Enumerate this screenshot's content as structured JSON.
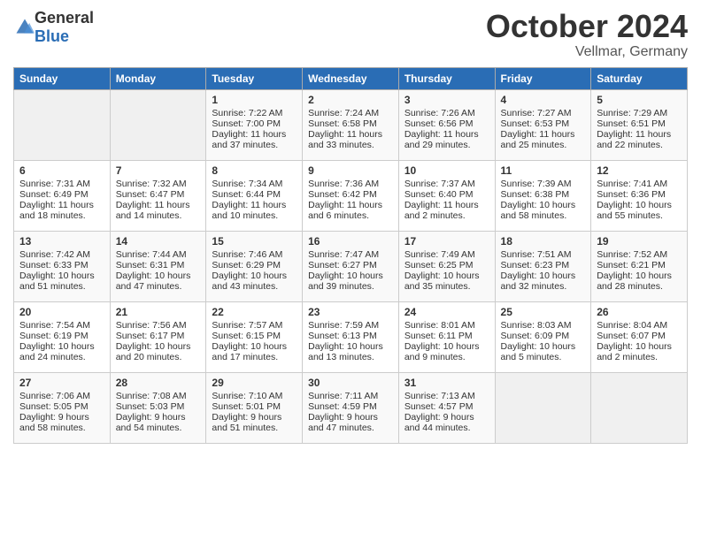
{
  "header": {
    "logo_general": "General",
    "logo_blue": "Blue",
    "month": "October 2024",
    "location": "Vellmar, Germany"
  },
  "days_of_week": [
    "Sunday",
    "Monday",
    "Tuesday",
    "Wednesday",
    "Thursday",
    "Friday",
    "Saturday"
  ],
  "weeks": [
    [
      {
        "day": "",
        "content": ""
      },
      {
        "day": "",
        "content": ""
      },
      {
        "day": "1",
        "content": "Sunrise: 7:22 AM\nSunset: 7:00 PM\nDaylight: 11 hours and 37 minutes."
      },
      {
        "day": "2",
        "content": "Sunrise: 7:24 AM\nSunset: 6:58 PM\nDaylight: 11 hours and 33 minutes."
      },
      {
        "day": "3",
        "content": "Sunrise: 7:26 AM\nSunset: 6:56 PM\nDaylight: 11 hours and 29 minutes."
      },
      {
        "day": "4",
        "content": "Sunrise: 7:27 AM\nSunset: 6:53 PM\nDaylight: 11 hours and 25 minutes."
      },
      {
        "day": "5",
        "content": "Sunrise: 7:29 AM\nSunset: 6:51 PM\nDaylight: 11 hours and 22 minutes."
      }
    ],
    [
      {
        "day": "6",
        "content": "Sunrise: 7:31 AM\nSunset: 6:49 PM\nDaylight: 11 hours and 18 minutes."
      },
      {
        "day": "7",
        "content": "Sunrise: 7:32 AM\nSunset: 6:47 PM\nDaylight: 11 hours and 14 minutes."
      },
      {
        "day": "8",
        "content": "Sunrise: 7:34 AM\nSunset: 6:44 PM\nDaylight: 11 hours and 10 minutes."
      },
      {
        "day": "9",
        "content": "Sunrise: 7:36 AM\nSunset: 6:42 PM\nDaylight: 11 hours and 6 minutes."
      },
      {
        "day": "10",
        "content": "Sunrise: 7:37 AM\nSunset: 6:40 PM\nDaylight: 11 hours and 2 minutes."
      },
      {
        "day": "11",
        "content": "Sunrise: 7:39 AM\nSunset: 6:38 PM\nDaylight: 10 hours and 58 minutes."
      },
      {
        "day": "12",
        "content": "Sunrise: 7:41 AM\nSunset: 6:36 PM\nDaylight: 10 hours and 55 minutes."
      }
    ],
    [
      {
        "day": "13",
        "content": "Sunrise: 7:42 AM\nSunset: 6:33 PM\nDaylight: 10 hours and 51 minutes."
      },
      {
        "day": "14",
        "content": "Sunrise: 7:44 AM\nSunset: 6:31 PM\nDaylight: 10 hours and 47 minutes."
      },
      {
        "day": "15",
        "content": "Sunrise: 7:46 AM\nSunset: 6:29 PM\nDaylight: 10 hours and 43 minutes."
      },
      {
        "day": "16",
        "content": "Sunrise: 7:47 AM\nSunset: 6:27 PM\nDaylight: 10 hours and 39 minutes."
      },
      {
        "day": "17",
        "content": "Sunrise: 7:49 AM\nSunset: 6:25 PM\nDaylight: 10 hours and 35 minutes."
      },
      {
        "day": "18",
        "content": "Sunrise: 7:51 AM\nSunset: 6:23 PM\nDaylight: 10 hours and 32 minutes."
      },
      {
        "day": "19",
        "content": "Sunrise: 7:52 AM\nSunset: 6:21 PM\nDaylight: 10 hours and 28 minutes."
      }
    ],
    [
      {
        "day": "20",
        "content": "Sunrise: 7:54 AM\nSunset: 6:19 PM\nDaylight: 10 hours and 24 minutes."
      },
      {
        "day": "21",
        "content": "Sunrise: 7:56 AM\nSunset: 6:17 PM\nDaylight: 10 hours and 20 minutes."
      },
      {
        "day": "22",
        "content": "Sunrise: 7:57 AM\nSunset: 6:15 PM\nDaylight: 10 hours and 17 minutes."
      },
      {
        "day": "23",
        "content": "Sunrise: 7:59 AM\nSunset: 6:13 PM\nDaylight: 10 hours and 13 minutes."
      },
      {
        "day": "24",
        "content": "Sunrise: 8:01 AM\nSunset: 6:11 PM\nDaylight: 10 hours and 9 minutes."
      },
      {
        "day": "25",
        "content": "Sunrise: 8:03 AM\nSunset: 6:09 PM\nDaylight: 10 hours and 5 minutes."
      },
      {
        "day": "26",
        "content": "Sunrise: 8:04 AM\nSunset: 6:07 PM\nDaylight: 10 hours and 2 minutes."
      }
    ],
    [
      {
        "day": "27",
        "content": "Sunrise: 7:06 AM\nSunset: 5:05 PM\nDaylight: 9 hours and 58 minutes."
      },
      {
        "day": "28",
        "content": "Sunrise: 7:08 AM\nSunset: 5:03 PM\nDaylight: 9 hours and 54 minutes."
      },
      {
        "day": "29",
        "content": "Sunrise: 7:10 AM\nSunset: 5:01 PM\nDaylight: 9 hours and 51 minutes."
      },
      {
        "day": "30",
        "content": "Sunrise: 7:11 AM\nSunset: 4:59 PM\nDaylight: 9 hours and 47 minutes."
      },
      {
        "day": "31",
        "content": "Sunrise: 7:13 AM\nSunset: 4:57 PM\nDaylight: 9 hours and 44 minutes."
      },
      {
        "day": "",
        "content": ""
      },
      {
        "day": "",
        "content": ""
      }
    ]
  ]
}
